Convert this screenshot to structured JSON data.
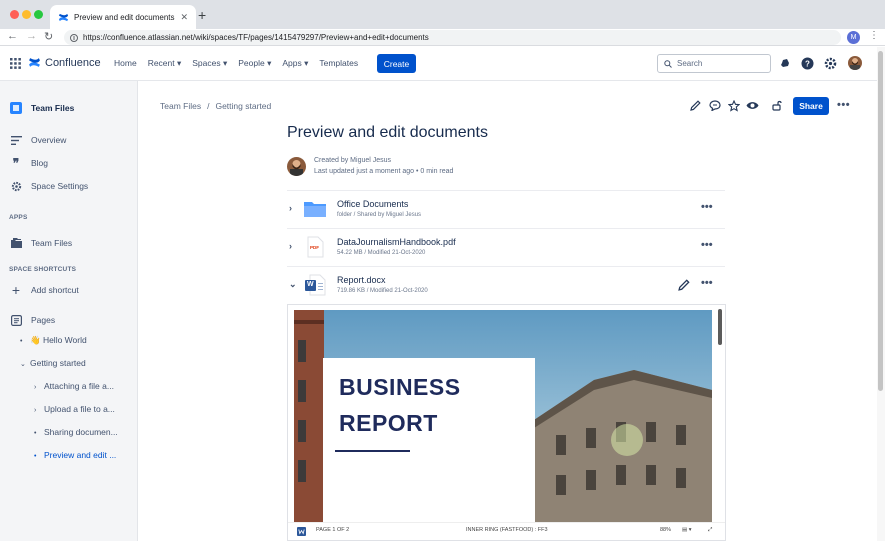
{
  "browser": {
    "tab_title": "Preview and edit documents -",
    "close_glyph": "✕",
    "new_tab_glyph": "+",
    "url": "https://confluence.atlassian.net/wiki/spaces/TF/pages/1415479297/Preview+and+edit+documents",
    "profile_initial": "M",
    "menu_glyph": "⋮",
    "back_glyph": "←",
    "forward_glyph": "→",
    "reload_glyph": "↻",
    "colors": {
      "close": "#ff5f57",
      "minimize": "#febc2e",
      "maximize": "#28c840"
    }
  },
  "header": {
    "product_name": "Confluence",
    "nav": [
      "Home",
      "Recent ▾",
      "Spaces ▾",
      "People ▾",
      "Apps ▾",
      "Templates"
    ],
    "create_label": "Create",
    "search_placeholder": "Search",
    "icons": [
      "notifications-icon",
      "help-icon",
      "settings-icon",
      "avatar"
    ]
  },
  "sidebar": {
    "space_name": "Team Files",
    "items": [
      {
        "label": "Overview",
        "icon": "overview-icon"
      },
      {
        "label": "Blog",
        "icon": "blog-quote-icon"
      },
      {
        "label": "Space Settings",
        "icon": "gear-icon"
      }
    ],
    "apps_heading": "APPS",
    "apps": [
      {
        "label": "Team Files",
        "icon": "team-files-icon"
      }
    ],
    "shortcuts_heading": "SPACE SHORTCUTS",
    "add_shortcut": "Add shortcut",
    "pages_label": "Pages",
    "tree": [
      {
        "label": "👋 Hello World",
        "marker": "•"
      },
      {
        "label": "Getting started",
        "marker": "⌄"
      },
      {
        "label": "Attaching a file a...",
        "marker": "›"
      },
      {
        "label": "Upload a file to a...",
        "marker": "›"
      },
      {
        "label": "Sharing documen...",
        "marker": "•"
      },
      {
        "label": "Preview and edit ...",
        "marker": "•"
      }
    ]
  },
  "page": {
    "breadcrumb": [
      "Team Files",
      "Getting started"
    ],
    "breadcrumb_separator": "/",
    "share_label": "Share",
    "more_glyph": "•••",
    "title": "Preview and edit documents",
    "created_by": "Created by Miguel Jesus",
    "updated": "Last updated just a moment ago  •  0 min read",
    "toolbar_icons": [
      "edit-icon",
      "comment-icon",
      "star-icon",
      "watch-icon",
      "restrictions-icon"
    ]
  },
  "files": [
    {
      "name": "Office Documents",
      "meta": "folder / Shared by Miguel Jesus",
      "type": "folder",
      "chevron": "›"
    },
    {
      "name": "DataJournalismHandbook.pdf",
      "meta": "54.22 MB / Modified 21-Oct-2020",
      "type": "pdf",
      "chevron": "›",
      "badge": "PDF"
    },
    {
      "name": "Report.docx",
      "meta": "719.86 KB / Modified 21-Oct-2020",
      "type": "docx",
      "chevron": "⌄",
      "badge": "W"
    }
  ],
  "preview": {
    "doc_title_line1": "BUSINESS",
    "doc_title_line2": "REPORT",
    "status_page": "PAGE 1 OF 2",
    "status_mid": "INNER RING (FASTFOOD) : FF3",
    "status_zoom": "88%",
    "status_view": "▤ ▾",
    "status_expand": "⤢"
  }
}
